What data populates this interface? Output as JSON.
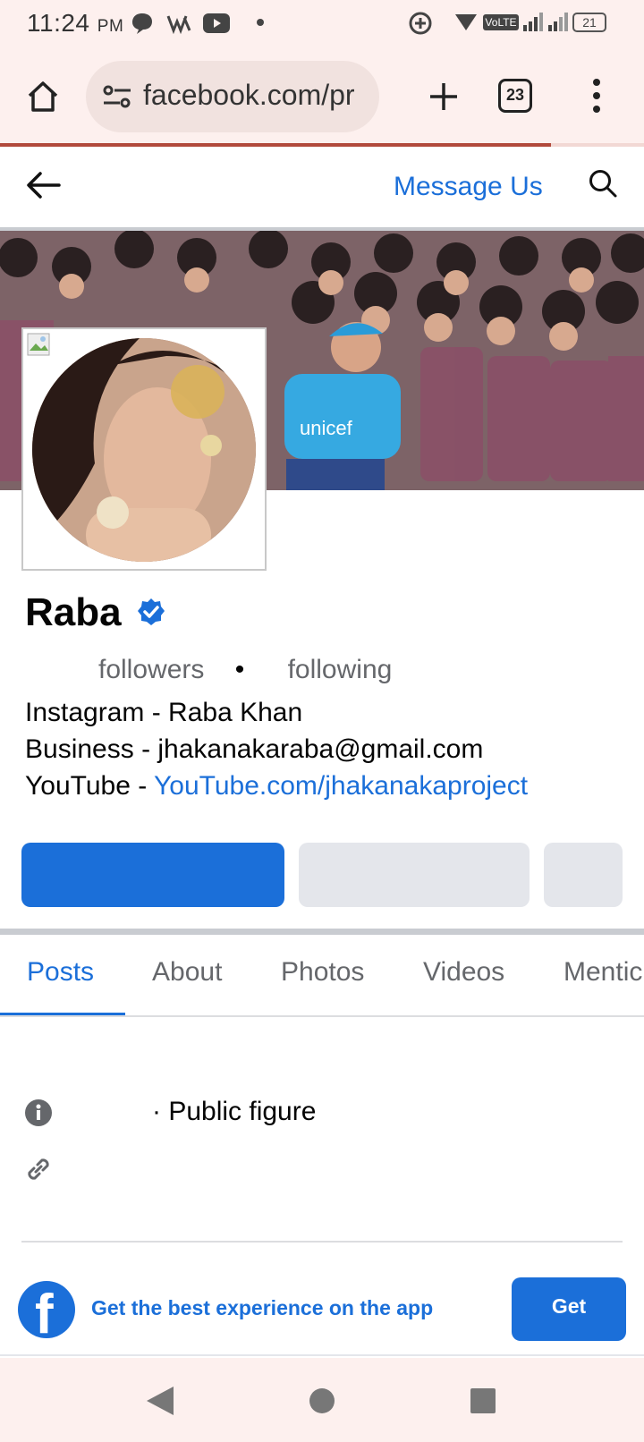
{
  "status_bar": {
    "time": "11:24",
    "ampm": "PM",
    "network_label": "VoLTE",
    "battery": "21"
  },
  "browser": {
    "url": "facebook.com/pr",
    "tab_count": "23",
    "load_progress": 0.855
  },
  "page_header": {
    "message_button": "Message Us"
  },
  "profile": {
    "name": "Raba",
    "verified": true,
    "followers_label": "followers",
    "dot": "•",
    "following_label": "following",
    "bio": [
      {
        "text": "Instagram - Raba Khan"
      },
      {
        "text": "Business - jhakanakaraba@gmail.com"
      },
      {
        "prefix": "YouTube - ",
        "link": "YouTube.com/jhakanakaproject"
      }
    ]
  },
  "tabs": [
    "Posts",
    "About",
    "Photos",
    "Videos",
    "Mentic"
  ],
  "intro": {
    "category": "· Public figure"
  },
  "app_banner": {
    "text": "Get the best experience on the app",
    "button": "Get"
  },
  "colors": {
    "accent": "#1b6fd9",
    "browser_chrome": "#fdf0ee"
  }
}
